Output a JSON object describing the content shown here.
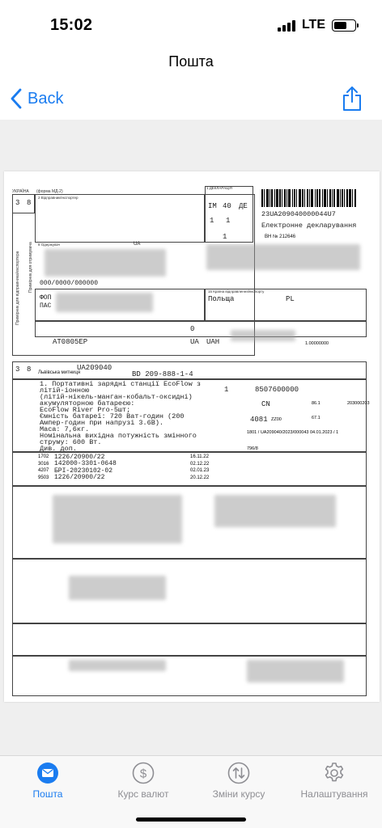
{
  "status_bar": {
    "time": "15:02",
    "network": "LTE"
  },
  "nav": {
    "title": "Пошта",
    "back_label": "Back"
  },
  "document": {
    "form_title": "УКРАЇНА",
    "form_code": "(форма МД-2)",
    "declaration_hdr": "1 ДЕКЛАРАЦІЯ",
    "im": "IM",
    "im2": "40",
    "de": "ДЕ",
    "forms_a": "1",
    "forms_b": "1",
    "ref_number": "23UA209040000044U7",
    "e_decl": "Електронне декларування",
    "vn": "ВН № 212646",
    "box3": "3",
    "box8": "8",
    "sender_label": "2 Відправник/експортер",
    "recipient_label": "8 Одержувач",
    "ua_hdr": "UA",
    "zip_line": "000/0000/000000",
    "fop": "ФОП",
    "pas": "ПАС",
    "origin_label": "15 Країна відправлення/експорту",
    "origin": "Польща",
    "pl": "PL",
    "vehicle": "AT0805EP",
    "ua_code": "UA",
    "uah": "UAH",
    "rate": "1.00000000",
    "customs_office": "Львівська митниця",
    "office_code": "UA209040",
    "bd": "BD 209-888-1-4",
    "box_zero": "0",
    "goods_line1": "1. Портативні зарядні станції EcoFlow з",
    "goods_line2": "літій-іонною",
    "goods_line3": "(літій-нікель-манган-кобальт-оксидні)",
    "goods_line4": "акумуляторною батареєю:",
    "goods_line5": "EcoFlow River Pro-5шт;",
    "goods_line6": "Ємність батареї: 720 Ват-годин (200",
    "goods_line7": "Ампер-годин при напрузі 3.6В).",
    "goods_line8": "Маса: 7,6кг.",
    "goods_line9": "Номінальна вихідна потужність змінного",
    "goods_line10": "струму: 600 Вт.",
    "goods_line11": "Див. доп.",
    "item_no": "1",
    "hs_code": "8507600000",
    "origin_cn": "CN",
    "gross": "86.1",
    "proc": "4081",
    "zz": "ZZ00",
    "net": "67.1",
    "prev_doc": "1801 / UA209040/2023/000043 04.01.2023 / 1",
    "pref": "203000203",
    "qty": "796/8",
    "docs": [
      {
        "code": "1702",
        "num": "1226/20900/22",
        "date": "16.11.22"
      },
      {
        "code": "3016",
        "num": "142000-3301-0648",
        "date": "02.12.22"
      },
      {
        "code": "4207",
        "num": "БРІ-20230102-02",
        "date": "02.01.23"
      },
      {
        "code": "9503",
        "num": "1226/20900/22",
        "date": "20.12.22"
      }
    ]
  },
  "tabs": [
    {
      "label": "Пошта",
      "icon": "mail-icon",
      "active": true
    },
    {
      "label": "Курс валют",
      "icon": "dollar-icon",
      "active": false
    },
    {
      "label": "Зміни курсу",
      "icon": "swap-icon",
      "active": false
    },
    {
      "label": "Налаштування",
      "icon": "gear-icon",
      "active": false
    }
  ],
  "colors": {
    "accent": "#1a7cf0",
    "inactive": "#8e8e93",
    "background": "#efefef"
  }
}
